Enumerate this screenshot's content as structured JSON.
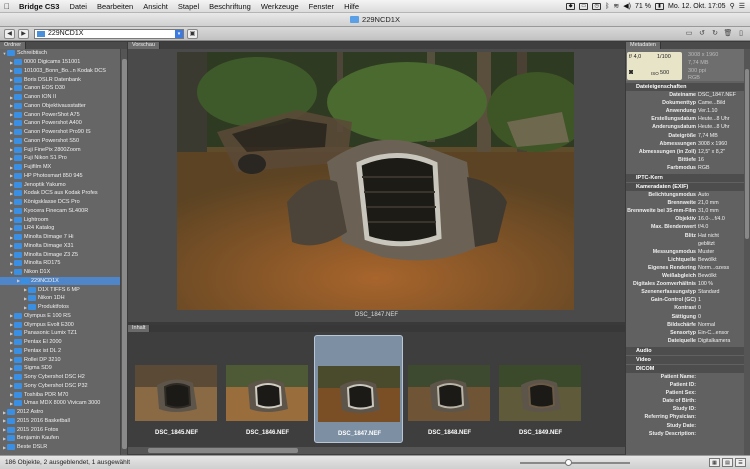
{
  "menubar": {
    "app_name": "Bridge CS3",
    "items": [
      "Datei",
      "Bearbeiten",
      "Ansicht",
      "Stapel",
      "Beschriftung",
      "Werkzeuge",
      "Fenster",
      "Hilfe"
    ],
    "battery": "71 %",
    "clock": "Mo. 12. Okt. 17:05"
  },
  "window": {
    "title": "229NCD1X"
  },
  "toolbar": {
    "path_value": "229NCD1X"
  },
  "left_panel": {
    "tab": "Ordner",
    "folders": [
      {
        "label": "Schreibtisch",
        "depth": 0,
        "expanded": true
      },
      {
        "label": "0000 Digicams 151001",
        "depth": 1
      },
      {
        "label": "101003_Bonn_Bo...n Kodak DCS",
        "depth": 1
      },
      {
        "label": "Boris DSLR Datenbank",
        "depth": 1
      },
      {
        "label": "Canon EOS D30",
        "depth": 1
      },
      {
        "label": "Canon ION II",
        "depth": 1
      },
      {
        "label": "Canon Objektivausstatter",
        "depth": 1
      },
      {
        "label": "Canon PowerShot A75",
        "depth": 1
      },
      {
        "label": "Canon Powershot A400",
        "depth": 1
      },
      {
        "label": "Canon Powershot Pro90 IS",
        "depth": 1
      },
      {
        "label": "Canon Powershot S50",
        "depth": 1
      },
      {
        "label": "Fuji FinePix 2800Zoom",
        "depth": 1
      },
      {
        "label": "Fuji Nikon S1 Pro",
        "depth": 1
      },
      {
        "label": "Fujifilm MX",
        "depth": 1
      },
      {
        "label": "HP Photosmart 850 945",
        "depth": 1
      },
      {
        "label": "Jenoptik Yakumo",
        "depth": 1
      },
      {
        "label": "Kodak DCS aus Kodak Profes",
        "depth": 1
      },
      {
        "label": "Königsklasse DCS Pro",
        "depth": 1
      },
      {
        "label": "Kyocera Finecam SL400R",
        "depth": 1
      },
      {
        "label": "Lightroom",
        "depth": 1
      },
      {
        "label": "LR4 Katalog",
        "depth": 1
      },
      {
        "label": "Minolta Dimage 7 Hi",
        "depth": 1
      },
      {
        "label": "Minolta Dimage X31",
        "depth": 1
      },
      {
        "label": "Minolta Dimage Z3 Z5",
        "depth": 1
      },
      {
        "label": "Minolta RD175",
        "depth": 1
      },
      {
        "label": "Nikon D1X",
        "depth": 1,
        "expanded": true
      },
      {
        "label": "229NCD1X",
        "depth": 2,
        "selected": true
      },
      {
        "label": "D1X TIFFS 6 MP",
        "depth": 3
      },
      {
        "label": "Nikon 1DH",
        "depth": 3
      },
      {
        "label": "Produktfotos",
        "depth": 3
      },
      {
        "label": "Olympus E 100 RS",
        "depth": 1
      },
      {
        "label": "Olympus Evolt E300",
        "depth": 1
      },
      {
        "label": "Panasonic Lumix TZ1",
        "depth": 1
      },
      {
        "label": "Pentax EI 2000",
        "depth": 1
      },
      {
        "label": "Pentax ist DL 2",
        "depth": 1
      },
      {
        "label": "Rollei DP 3210",
        "depth": 1
      },
      {
        "label": "Sigma SD9",
        "depth": 1
      },
      {
        "label": "Sony Cybershot DSC H2",
        "depth": 1
      },
      {
        "label": "Sony Cybershot DSC P32",
        "depth": 1
      },
      {
        "label": "Toshiba PDR M70",
        "depth": 1
      },
      {
        "label": "Umax MDX 8000 Vivicam 3000",
        "depth": 1
      },
      {
        "label": "2012 Astro",
        "depth": 0
      },
      {
        "label": "2015 2016 Basketball",
        "depth": 0
      },
      {
        "label": "2015 2016 Fotos",
        "depth": 0
      },
      {
        "label": "Benjamin Kaufen",
        "depth": 0
      },
      {
        "label": "Beste DSLR",
        "depth": 0
      }
    ]
  },
  "preview": {
    "tab": "Vorschau",
    "caption": "DSC_1847.NEF"
  },
  "content": {
    "tab": "Inhalt",
    "thumbs": [
      {
        "label": "DSC_1845.NEF"
      },
      {
        "label": "DSC_1846.NEF"
      },
      {
        "label": "DSC_1847.NEF",
        "selected": true
      },
      {
        "label": "DSC_1848.NEF"
      },
      {
        "label": "DSC_1849.NEF"
      }
    ]
  },
  "metadata": {
    "tab": "Metadaten",
    "chip": {
      "aperture": "f/ 4,0",
      "shutter": "1/100",
      "iso_label": "ISO",
      "iso": "500"
    },
    "summary": [
      "3008 x 1960",
      "7,74 MB",
      "300 ppi",
      "RGB"
    ],
    "file_section": "Dateieigenschaften",
    "file_props": [
      {
        "k": "Dateiname",
        "v": "DSC_1847.NEF"
      },
      {
        "k": "Dokumenttyp",
        "v": "Came...Bild"
      },
      {
        "k": "Anwendung",
        "v": "Ver.1.10"
      },
      {
        "k": "Erstellungsdatum",
        "v": "Heute...8 Uhr"
      },
      {
        "k": "Änderungsdatum",
        "v": "Heute...8 Uhr"
      },
      {
        "k": "Dateigröße",
        "v": "7,74 MB"
      },
      {
        "k": "Abmessungen",
        "v": "3008 x 1960"
      },
      {
        "k": "Abmessungen (in Zoll)",
        "v": "12,5\" x 8,2\""
      },
      {
        "k": "Bittiefe",
        "v": "16"
      },
      {
        "k": "Farbmodus",
        "v": "RGB"
      }
    ],
    "iptc_section": "IPTC-Kern",
    "exif_section": "Kameradaten (EXIF)",
    "exif_props": [
      {
        "k": "Belichtungsmodus",
        "v": "Auto"
      },
      {
        "k": "Brennweite",
        "v": "21,0 mm"
      },
      {
        "k": "Brennweite bei 35-mm-Film",
        "v": "31,0 mm"
      },
      {
        "k": "Objektiv",
        "v": "16.0-...f/4.0"
      },
      {
        "k": "Max. Blendenwert",
        "v": "f/4.0"
      },
      {
        "k": "Blitz",
        "v": "Hat nicht"
      },
      {
        "k": "",
        "v": "geblitzt"
      },
      {
        "k": "Messungsmodus",
        "v": "Muster"
      },
      {
        "k": "Lichtquelle",
        "v": "Bewölkt"
      },
      {
        "k": "Eigenes Rendering",
        "v": "Norm...ozess"
      },
      {
        "k": "Weißabgleich",
        "v": "Bewölkt"
      },
      {
        "k": "Digitales Zoomverhältnis",
        "v": "100 %"
      },
      {
        "k": "Szenenerfassungstyp",
        "v": "Standard"
      },
      {
        "k": "Gain-Control (GC)",
        "v": "1"
      },
      {
        "k": "Kontrast",
        "v": "0"
      },
      {
        "k": "Sättigung",
        "v": "0"
      },
      {
        "k": "Bildschärfe",
        "v": "Normal"
      },
      {
        "k": "Sensortyp",
        "v": "Ein-C...ensor"
      },
      {
        "k": "Dateiquelle",
        "v": "Digitalkamera"
      }
    ],
    "audio_section": "Audio",
    "video_section": "Video",
    "dicom_section": "DICOM",
    "dicom_props": [
      {
        "k": "Patient Name:",
        "v": ""
      },
      {
        "k": "Patient ID:",
        "v": ""
      },
      {
        "k": "Patient Sex:",
        "v": ""
      },
      {
        "k": "Date of Birth:",
        "v": ""
      },
      {
        "k": "Study ID:",
        "v": ""
      },
      {
        "k": "Referring Physician:",
        "v": ""
      },
      {
        "k": "Study Date:",
        "v": ""
      },
      {
        "k": "Study Description:",
        "v": ""
      }
    ]
  },
  "status": {
    "text": "186 Objekte, 2 ausgeblendet, 1 ausgewählt"
  }
}
